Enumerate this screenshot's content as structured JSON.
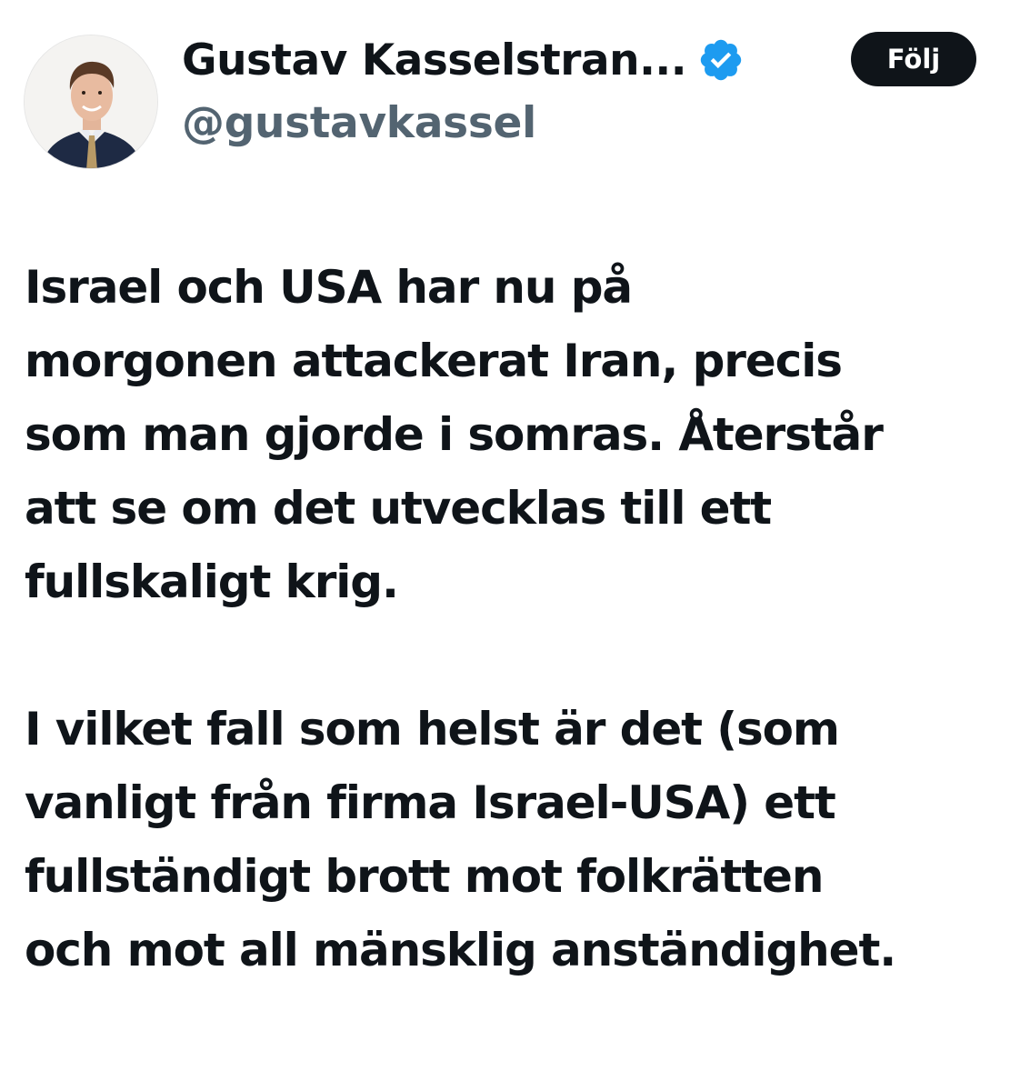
{
  "author": {
    "display_name": "Gustav Kasselstran...",
    "handle": "@gustavkassel",
    "verified_icon": "verified-badge-icon",
    "verified_color": "#1d9bf0"
  },
  "follow_button": {
    "label": "Följ"
  },
  "tweet": {
    "paragraphs": [
      {
        "lines": [
          "Israel och USA har nu på",
          "morgonen attackerat Iran, precis",
          "som man gjorde i somras. Återstår",
          "att se om det utvecklas till ett",
          "fullskaligt krig."
        ]
      },
      {
        "lines": [
          "I vilket fall som helst är det (som",
          "vanligt från firma Israel-USA) ett",
          "fullständigt brott mot folkrätten",
          "och mot all mänsklig anständighet."
        ]
      }
    ]
  }
}
